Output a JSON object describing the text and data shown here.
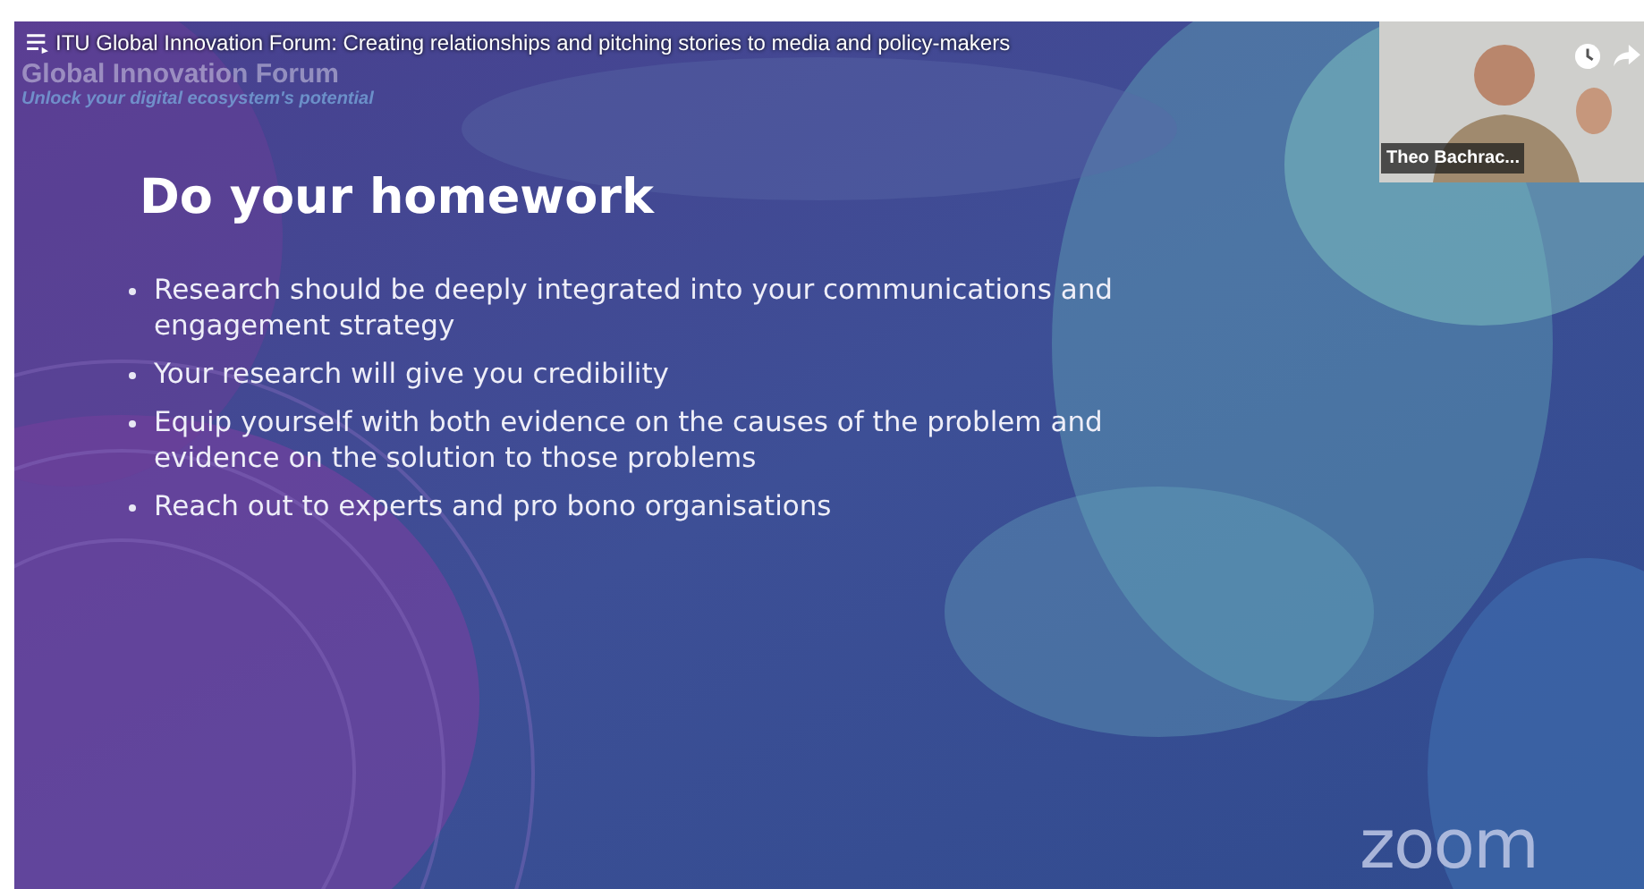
{
  "player": {
    "title": "ITU Global Innovation Forum: Creating relationships and pitching stories to media and policy-makers"
  },
  "slide": {
    "header": "Global Innovation Forum",
    "tagline": "Unlock your digital ecosystem's potential",
    "heading": "Do your homework",
    "bullets": [
      "Research should be deeply integrated into your communications and engagement strategy",
      "Your research will give you credibility",
      "Equip yourself with both evidence on the causes of the problem and evidence on the solution to those problems",
      "Reach out to experts and pro bono organisations"
    ]
  },
  "webcam": {
    "name": "Theo Bachrac..."
  },
  "logo": "zoom"
}
